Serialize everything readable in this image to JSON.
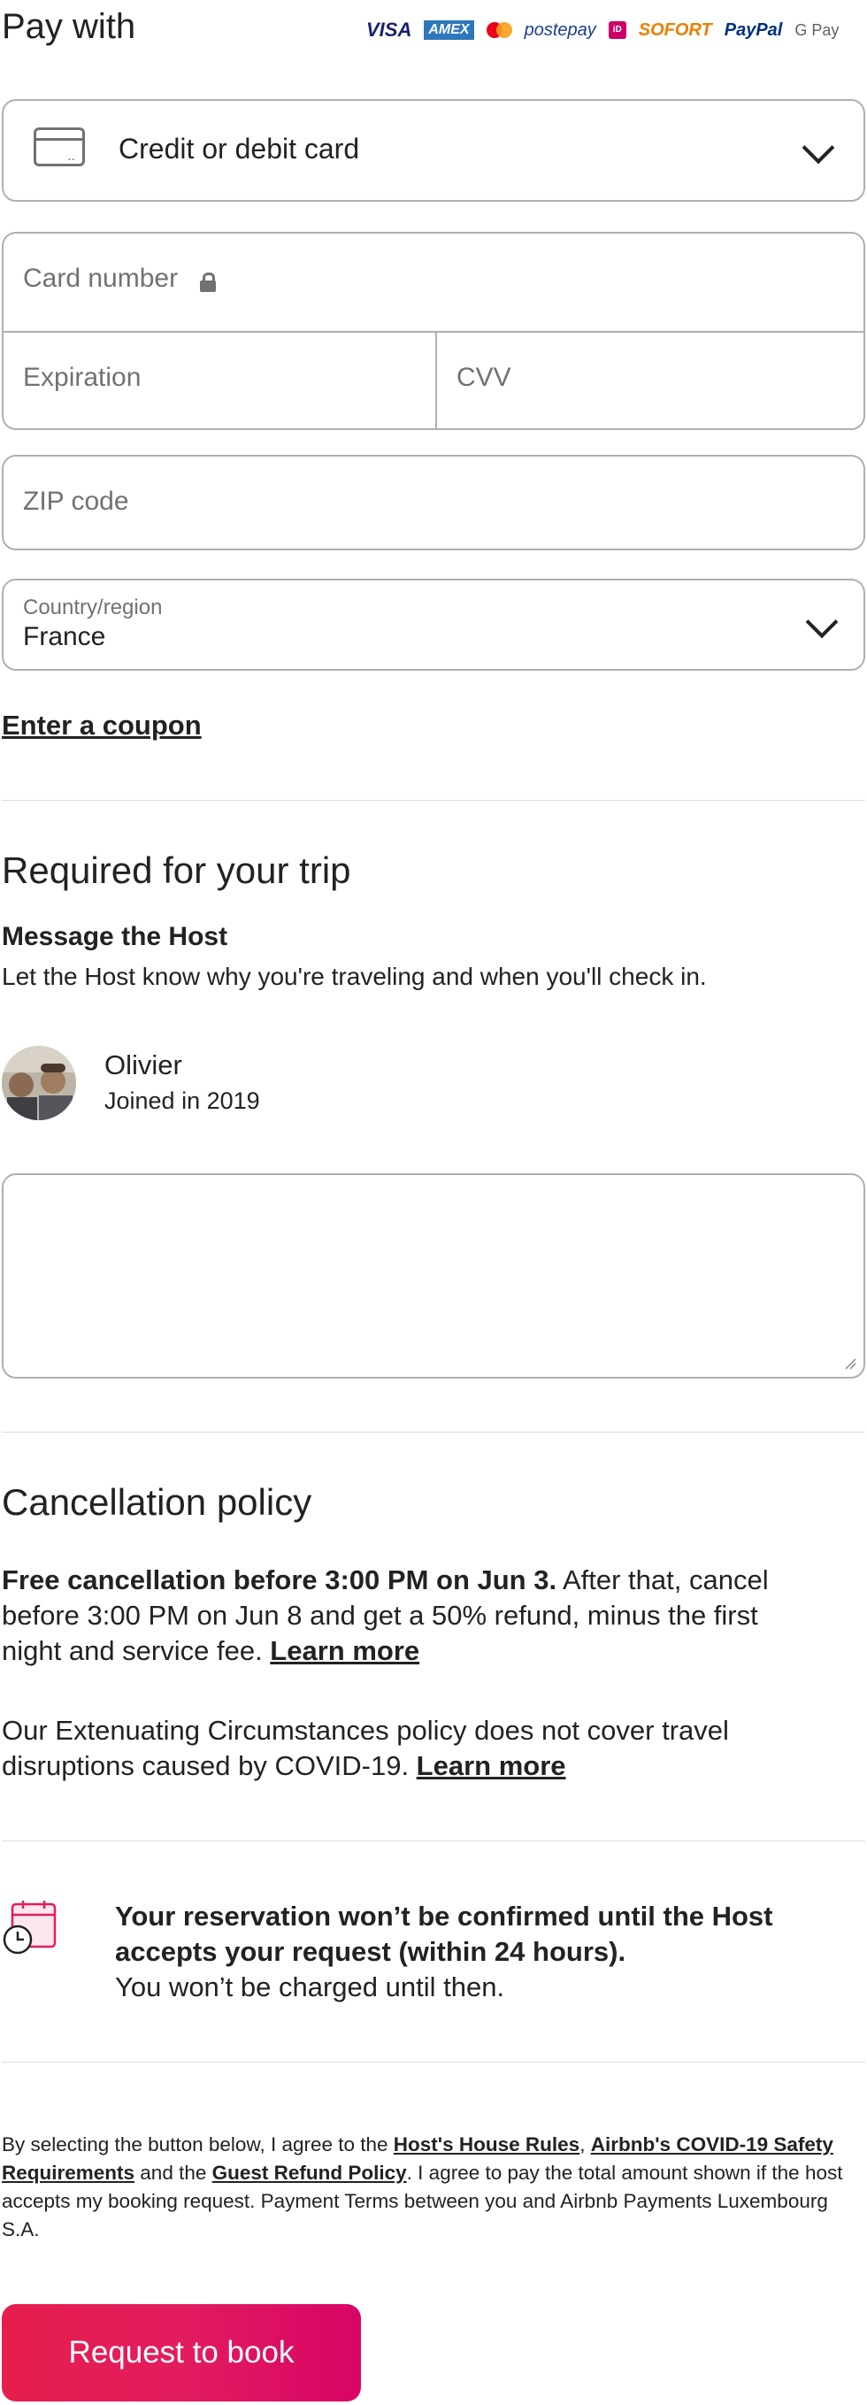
{
  "payment": {
    "title": "Pay with",
    "logos": [
      "VISA",
      "AMEX",
      "mastercard",
      "postepay",
      "iD",
      "SOFORT",
      "PayPal",
      "G Pay"
    ],
    "method_selected": "Credit or debit card",
    "card_number_placeholder": "Card number",
    "expiration_placeholder": "Expiration",
    "cvv_placeholder": "CVV",
    "zip_placeholder": "ZIP code",
    "country_label": "Country/region",
    "country_value": "France",
    "coupon_link": "Enter a coupon"
  },
  "required": {
    "title": "Required for your trip",
    "message_title": "Message the Host",
    "message_subtitle": "Let the Host know why you're traveling and when you'll check in.",
    "host_name": "Olivier",
    "host_joined": "Joined in 2019",
    "message_value": ""
  },
  "cancellation": {
    "title": "Cancellation policy",
    "free_bold": "Free cancellation before 3:00 PM on Jun 3.",
    "free_rest": " After that, cancel before 3:00 PM on Jun 8 and get a 50% refund, minus the first night and service fee. ",
    "learn_more_1": "Learn more",
    "ext_text": "Our Extenuating Circumstances policy does not cover travel disruptions caused by COVID-19. ",
    "learn_more_2": "Learn more"
  },
  "reservation": {
    "bold": "Your reservation won’t be confirmed until the Host accepts your request (within 24 hours).",
    "sub": "You won’t be charged until then."
  },
  "legal": {
    "p1": "By selecting the button below, I agree to the ",
    "link_rules": "Host's House Rules",
    "sep1": ", ",
    "link_covid": "Airbnb's COVID-19 Safety Requirements",
    "p2": " and the ",
    "link_refund": "Guest Refund Policy",
    "p3": ". I agree to pay the total amount shown if the host accepts my booking request. Payment Terms between you and Airbnb Payments Luxembourg S.A."
  },
  "cta": {
    "label": "Request to book"
  },
  "colors": {
    "brand": "#e31c5f",
    "border": "#b0b0b0",
    "divider": "#dddddd",
    "muted": "#717171"
  }
}
